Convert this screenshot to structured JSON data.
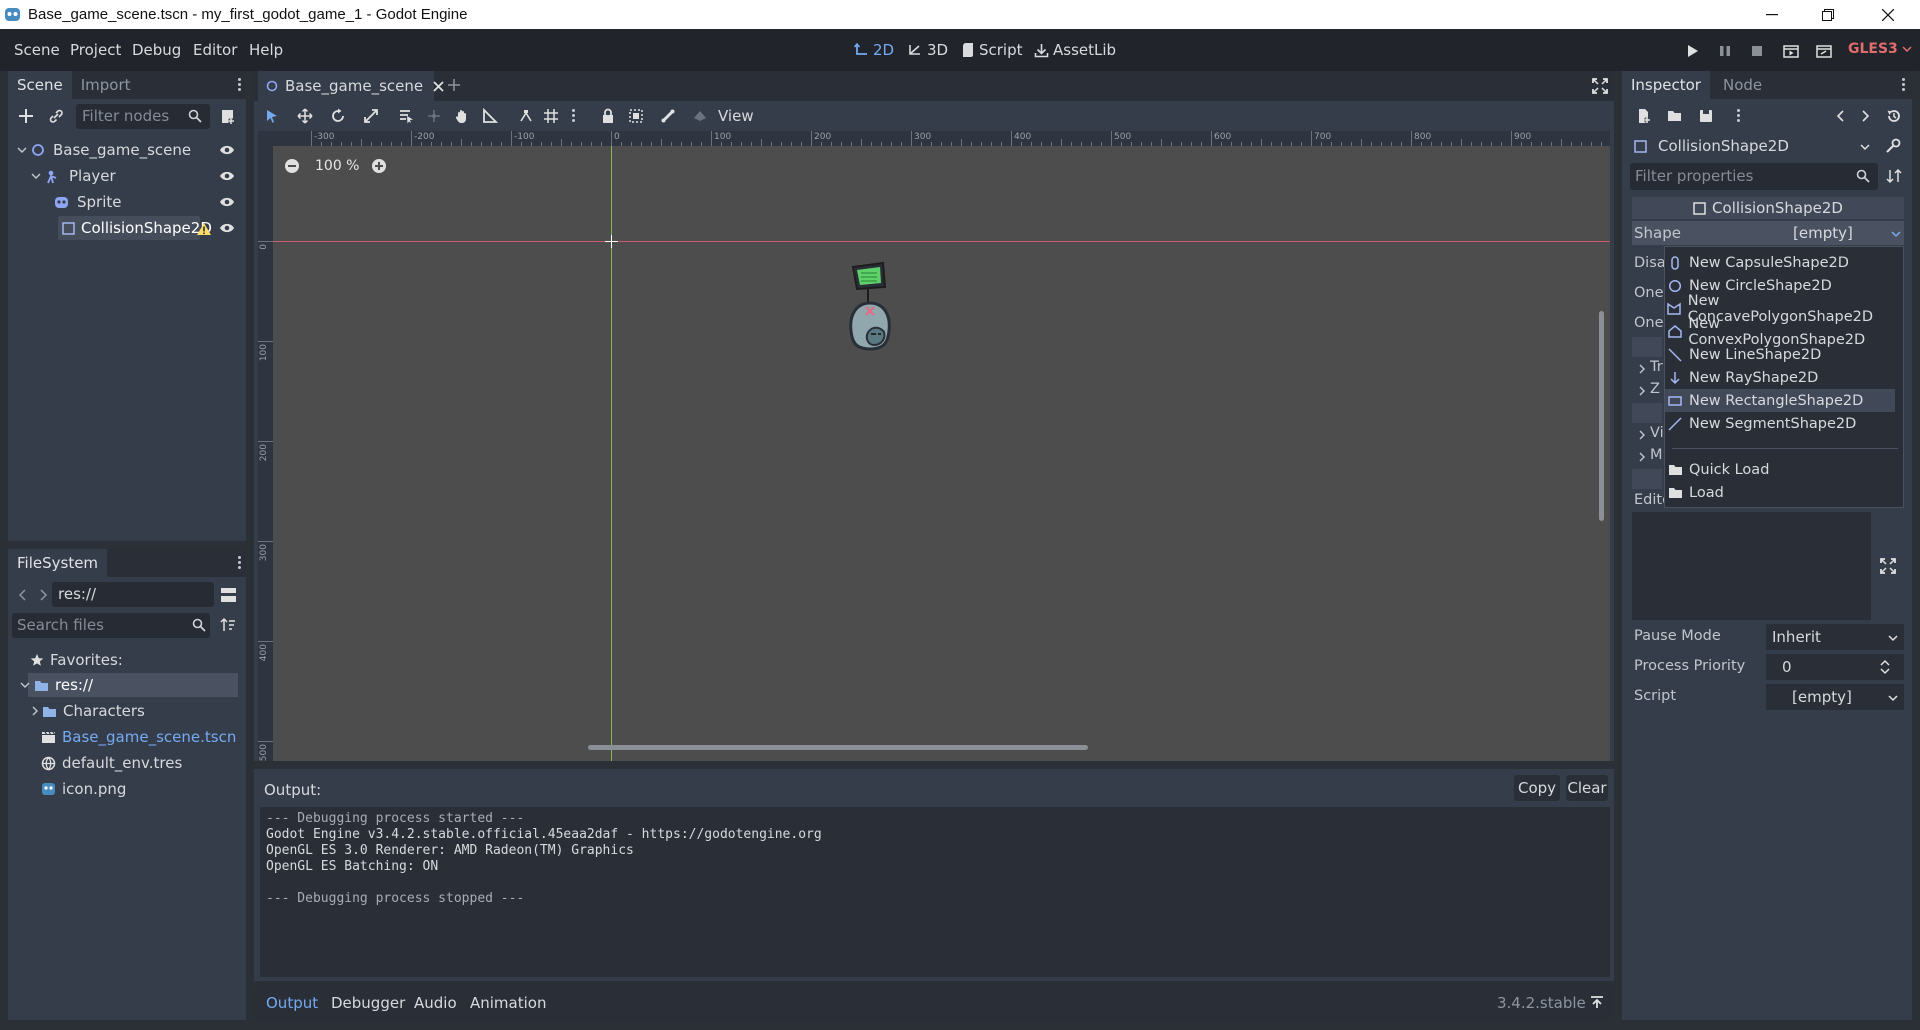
{
  "window": {
    "title": "Base_game_scene.tscn - my_first_godot_game_1 - Godot Engine"
  },
  "menubar": {
    "menus": [
      "Scene",
      "Project",
      "Debug",
      "Editor",
      "Help"
    ],
    "workspaces": {
      "w2d": "2D",
      "w3d": "3D",
      "script": "Script",
      "assetlib": "AssetLib"
    },
    "renderer": "GLES3"
  },
  "scene_dock": {
    "tabs": {
      "scene": "Scene",
      "import": "Import"
    },
    "filter_placeholder": "Filter nodes",
    "nodes": [
      {
        "name": "Base_game_scene",
        "icon": "node2d-icon"
      },
      {
        "name": "Player",
        "icon": "kinematic-body-icon"
      },
      {
        "name": "Sprite",
        "icon": "sprite-icon"
      },
      {
        "name": "CollisionShape2D",
        "icon": "collision-shape-icon",
        "selected": true,
        "warning": true
      }
    ]
  },
  "filesystem": {
    "title": "FileSystem",
    "path": "res://",
    "search_placeholder": "Search files",
    "favorites": "Favorites:",
    "items": [
      {
        "name": "res://",
        "icon": "folder-icon"
      },
      {
        "name": "Characters",
        "icon": "folder-icon"
      },
      {
        "name": "Base_game_scene.tscn",
        "icon": "scene-file-icon"
      },
      {
        "name": "default_env.tres",
        "icon": "environment-icon"
      },
      {
        "name": "icon.png",
        "icon": "image-icon"
      }
    ]
  },
  "editor_tab": {
    "name": "Base_game_scene"
  },
  "viewport": {
    "view_menu": "View",
    "zoom": "100 %",
    "ruler_h": [
      "-300",
      "-200",
      "-100",
      "0",
      "100",
      "200",
      "300",
      "400",
      "500",
      "600",
      "700",
      "800",
      "900"
    ],
    "ruler_v": [
      "0",
      "100",
      "200",
      "300",
      "400",
      "500"
    ]
  },
  "output": {
    "title": "Output:",
    "copy_label": "Copy",
    "clear_label": "Clear",
    "lines": [
      "--- Debugging process started ---",
      "Godot Engine v3.4.2.stable.official.45eaa2daf - https://godotengine.org",
      "OpenGL ES 3.0 Renderer: AMD Radeon(TM) Graphics",
      "OpenGL ES Batching: ON",
      "",
      "--- Debugging process stopped ---"
    ]
  },
  "bottom_tabs": {
    "output": "Output",
    "debugger": "Debugger",
    "audio": "Audio",
    "animation": "Animation"
  },
  "version": "3.4.2.stable",
  "inspector": {
    "tabs": {
      "inspector": "Inspector",
      "node": "Node"
    },
    "object": "CollisionShape2D",
    "filter_placeholder": "Filter properties",
    "section": "CollisionShape2D",
    "shape_label": "Shape",
    "shape_value": "[empty]",
    "partial_labels": [
      "Disa",
      "One",
      "One",
      "Tr",
      "Z",
      "Vi",
      "M",
      "Edito"
    ],
    "pause_mode_label": "Pause Mode",
    "pause_mode_value": "Inherit",
    "process_priority_label": "Process Priority",
    "process_priority_value": "0",
    "script_label": "Script",
    "script_value": "[empty]"
  },
  "shape_dropdown": {
    "items": [
      {
        "label": "New CapsuleShape2D",
        "icon": "capsule-icon"
      },
      {
        "label": "New CircleShape2D",
        "icon": "circle-icon"
      },
      {
        "label": "New ConcavePolygonShape2D",
        "icon": "concave-polygon-icon"
      },
      {
        "label": "New ConvexPolygonShape2D",
        "icon": "convex-polygon-icon"
      },
      {
        "label": "New LineShape2D",
        "icon": "line-icon"
      },
      {
        "label": "New RayShape2D",
        "icon": "ray-icon"
      },
      {
        "label": "New RectangleShape2D",
        "icon": "rectangle-icon",
        "highlighted": true
      },
      {
        "label": "New SegmentShape2D",
        "icon": "segment-icon"
      }
    ],
    "load_items": [
      {
        "label": "Quick Load",
        "icon": "folder-icon"
      },
      {
        "label": "Load",
        "icon": "folder-icon"
      }
    ]
  },
  "colors": {
    "accent": "#75aaf2",
    "warning": "#ffdd65",
    "background": "#21242a",
    "panel": "#363d4a",
    "viewport": "#4d4d4d"
  }
}
